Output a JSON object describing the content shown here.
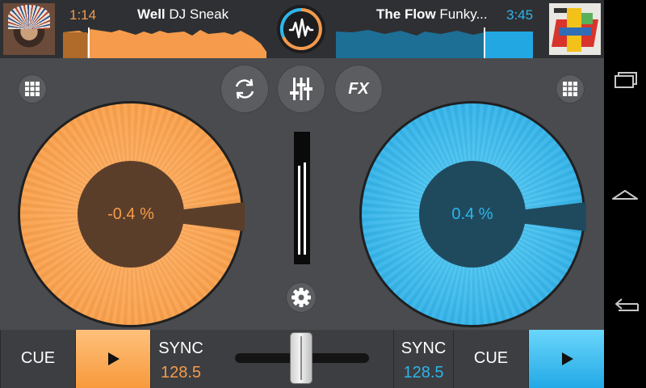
{
  "deck_left": {
    "time": "1:14",
    "title": "Well",
    "artist": "DJ Sneak",
    "pitch": "-0.4 %",
    "cue_label": "CUE",
    "sync_label": "SYNC",
    "bpm": "128.5",
    "color": "#f8993f",
    "cover_icon": "album-cover-feather-headdress"
  },
  "deck_right": {
    "time": "3:45",
    "title": "The Flow",
    "artist": "Funky...",
    "pitch": "0.4 %",
    "cue_label": "CUE",
    "sync_label": "SYNC",
    "bpm": "128.5",
    "color": "#22a7e3",
    "cover_icon": "album-cover-geometric"
  },
  "center": {
    "fx_label": "FX",
    "logo_icon": "waveform-logo-icon",
    "loop_icon": "loop-icon",
    "mixer_icon": "mixer-sliders-icon",
    "settings_icon": "gear-icon"
  },
  "navbar": {
    "icons": [
      "recent-apps-icon",
      "home-icon",
      "back-icon"
    ]
  }
}
